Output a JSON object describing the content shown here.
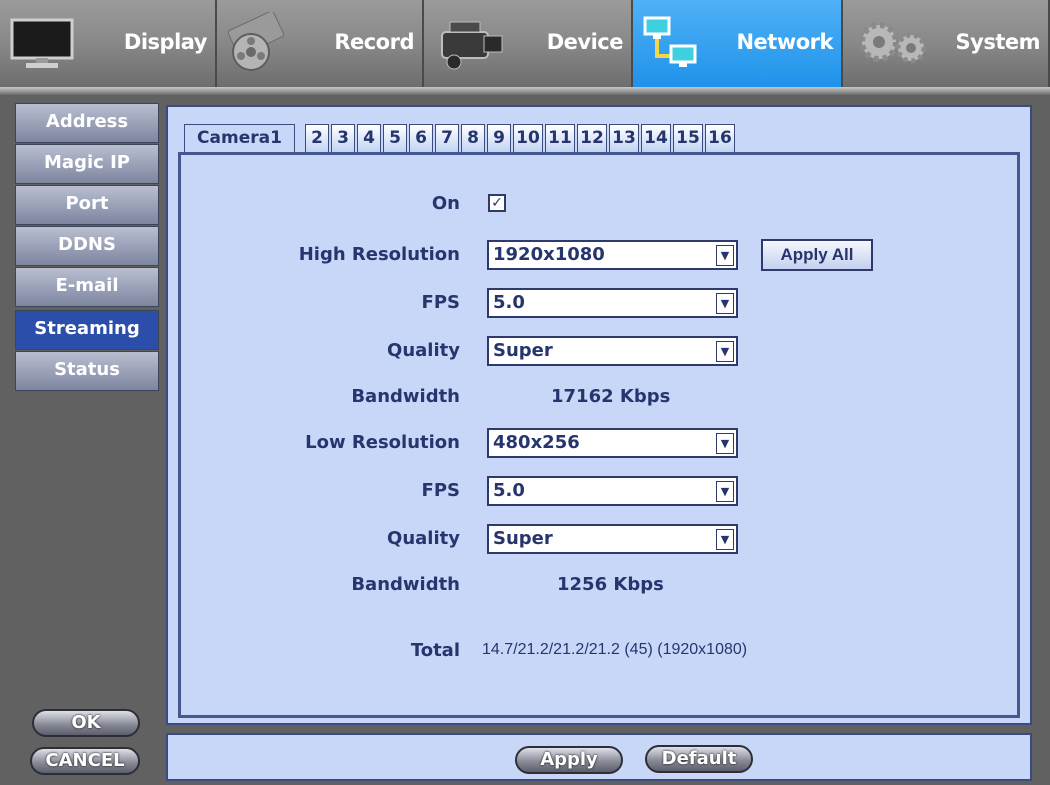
{
  "nav": {
    "tabs": [
      {
        "label": "Display",
        "icon": "monitor-icon"
      },
      {
        "label": "Record",
        "icon": "film-reel-icon"
      },
      {
        "label": "Device",
        "icon": "camcorder-icon"
      },
      {
        "label": "Network",
        "icon": "network-icon"
      },
      {
        "label": "System",
        "icon": "gears-icon"
      }
    ],
    "active": "Network"
  },
  "sidebar": {
    "items": [
      "Address",
      "Magic IP",
      "Port",
      "DDNS",
      "E-mail",
      "Streaming",
      "Status"
    ],
    "active": "Streaming"
  },
  "buttons": {
    "ok": "OK",
    "cancel": "CANCEL",
    "apply": "Apply",
    "default": "Default",
    "apply_all": "Apply All"
  },
  "camera_tabs": [
    "Camera1",
    "2",
    "3",
    "4",
    "5",
    "6",
    "7",
    "8",
    "9",
    "10",
    "11",
    "12",
    "13",
    "14",
    "15",
    "16"
  ],
  "form": {
    "on_label": "On",
    "on_checked": true,
    "on_mark": "✓",
    "high_resolution_label": "High Resolution",
    "high_resolution": "1920x1080",
    "high_fps_label": "FPS",
    "high_fps": "5.0",
    "high_quality_label": "Quality",
    "high_quality": "Super",
    "high_bandwidth_label": "Bandwidth",
    "high_bandwidth": "17162 Kbps",
    "low_resolution_label": "Low Resolution",
    "low_resolution": "480x256",
    "low_fps_label": "FPS",
    "low_fps": "5.0",
    "low_quality_label": "Quality",
    "low_quality": "Super",
    "low_bandwidth_label": "Bandwidth",
    "low_bandwidth": "1256 Kbps",
    "total_label": "Total",
    "total": "14.7/21.2/21.2/21.2 (45) (1920x1080)",
    "dropdown_arrow": "▼"
  },
  "colors": {
    "active_nav": "#1f92ea",
    "active_sidebar": "#2a4ea9",
    "panel": "#c8d7f7",
    "text": "#26356e"
  }
}
